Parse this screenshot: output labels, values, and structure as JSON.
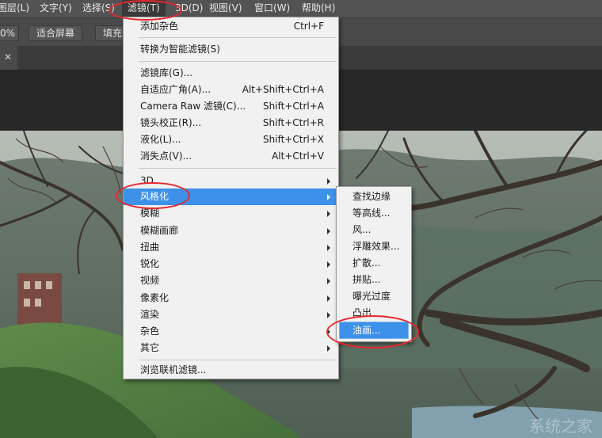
{
  "menubar": {
    "items": [
      {
        "label": "图层(L)"
      },
      {
        "label": "文字(Y)"
      },
      {
        "label": "选择(S)"
      },
      {
        "label": "滤镜(T)"
      },
      {
        "label": "3D(D)"
      },
      {
        "label": "视图(V)"
      },
      {
        "label": "窗口(W)"
      },
      {
        "label": "帮助(H)"
      }
    ]
  },
  "options_bar": {
    "zoom_value": "0%",
    "fit_screen_label": "适合屏幕",
    "fill_screen_label": "填充"
  },
  "filter_menu": {
    "items": [
      {
        "label": "添加杂色",
        "shortcut": "Ctrl+F"
      },
      {
        "label": "转换为智能滤镜(S)"
      },
      {
        "label": "滤镜库(G)..."
      },
      {
        "label": "自适应广角(A)...",
        "shortcut": "Alt+Shift+Ctrl+A"
      },
      {
        "label": "Camera Raw 滤镜(C)...",
        "shortcut": "Shift+Ctrl+A"
      },
      {
        "label": "镜头校正(R)...",
        "shortcut": "Shift+Ctrl+R"
      },
      {
        "label": "液化(L)...",
        "shortcut": "Shift+Ctrl+X"
      },
      {
        "label": "消失点(V)...",
        "shortcut": "Alt+Ctrl+V"
      },
      {
        "label": "3D"
      },
      {
        "label": "风格化"
      },
      {
        "label": "模糊"
      },
      {
        "label": "模糊画廊"
      },
      {
        "label": "扭曲"
      },
      {
        "label": "锐化"
      },
      {
        "label": "视频"
      },
      {
        "label": "像素化"
      },
      {
        "label": "渲染"
      },
      {
        "label": "杂色"
      },
      {
        "label": "其它"
      },
      {
        "label": "浏览联机滤镜..."
      }
    ]
  },
  "stylize_submenu": {
    "items": [
      {
        "label": "查找边缘"
      },
      {
        "label": "等高线..."
      },
      {
        "label": "风..."
      },
      {
        "label": "浮雕效果..."
      },
      {
        "label": "扩散..."
      },
      {
        "label": "拼贴..."
      },
      {
        "label": "曝光过度"
      },
      {
        "label": "凸出"
      },
      {
        "label": "油画..."
      }
    ]
  },
  "watermark": "系统之家",
  "colors": {
    "highlight": "#3d91e8",
    "annotation": "#e8272d",
    "menu_bg": "#f1f1f1",
    "menubar_bg": "#535353"
  }
}
